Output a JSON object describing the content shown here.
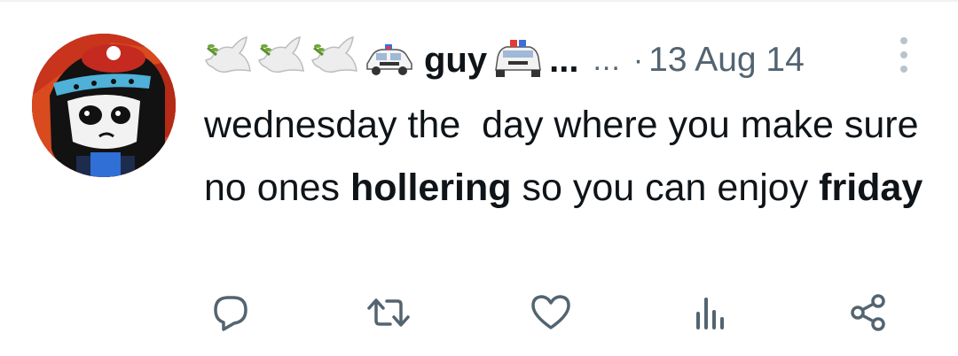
{
  "tweet": {
    "author": {
      "display_name": "guy",
      "name_truncation": "...",
      "handle_truncation": "...",
      "avatar_icon": "cartoon-character-avatar",
      "name_emojis": [
        "dove-icon",
        "dove-icon",
        "dove-icon",
        "police-car-icon"
      ],
      "trailing_emoji": "police-car-front-icon"
    },
    "separator": "·",
    "timestamp": "13 Aug 14",
    "text": {
      "part1": "wednesday the  day where you make sure no ones ",
      "bold1": "hollering",
      "part2": " so you can enjoy ",
      "bold2": "friday"
    },
    "actions": [
      {
        "name": "reply",
        "icon": "reply-bubble-icon"
      },
      {
        "name": "repost",
        "icon": "repost-arrows-icon"
      },
      {
        "name": "like",
        "icon": "heart-icon"
      },
      {
        "name": "views",
        "icon": "analytics-bars-icon"
      },
      {
        "name": "share",
        "icon": "share-nodes-icon"
      }
    ],
    "colors": {
      "text": "#0f1419",
      "secondary": "#536471",
      "action_icon": "#536471"
    }
  }
}
